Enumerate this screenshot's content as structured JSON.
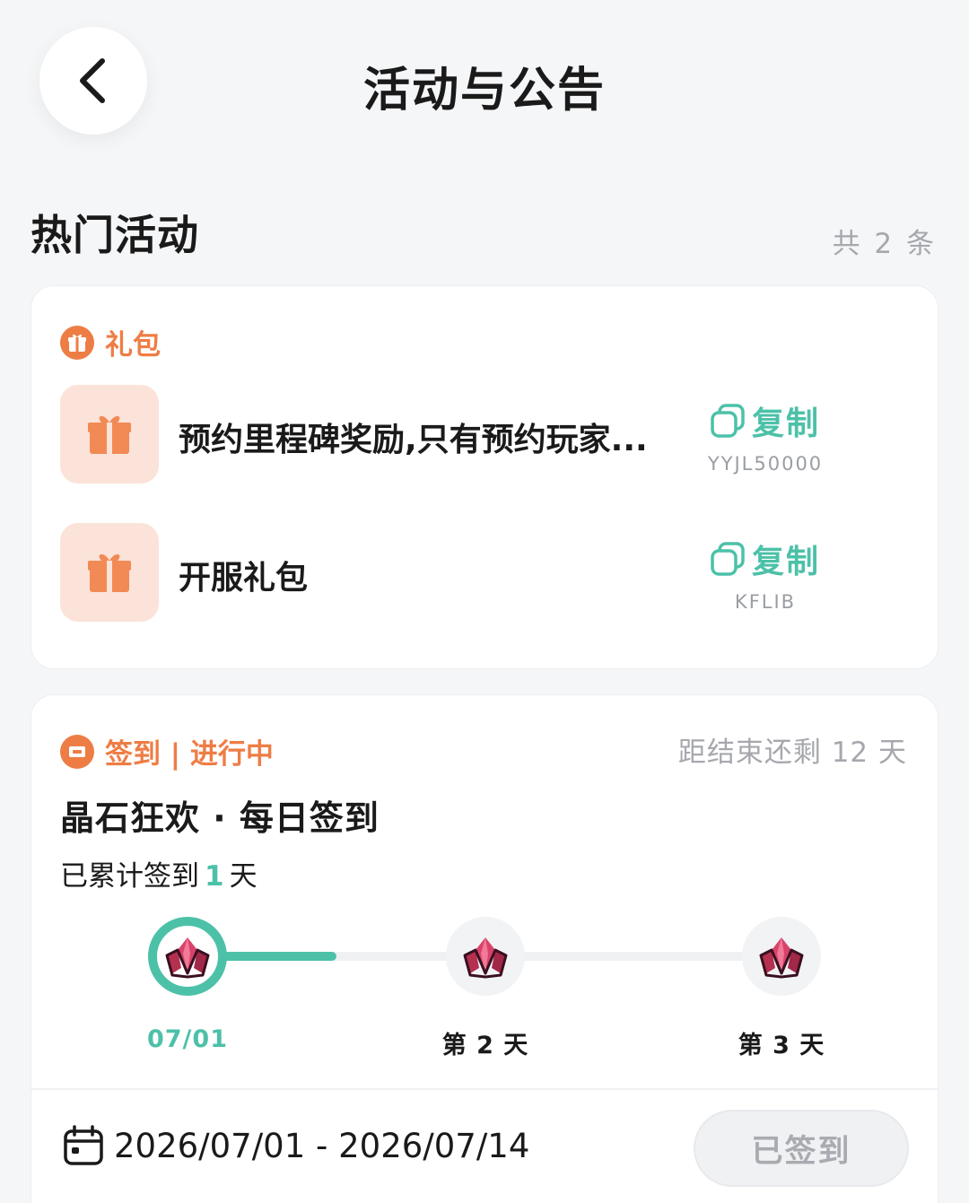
{
  "header": {
    "title": "活动与公告",
    "back_icon": "chevron-left-icon"
  },
  "section": {
    "title": "热门活动",
    "count": "共 2 条"
  },
  "gift_card": {
    "tag": "礼包",
    "tag_icon": "gift-icon",
    "items": [
      {
        "name": "预约里程碑奖励,只有预约玩家...",
        "copy_label": "复制",
        "code": "YYJL50000"
      },
      {
        "name": "开服礼包",
        "copy_label": "复制",
        "code": "KFLIB"
      }
    ]
  },
  "checkin_card": {
    "tag": "签到 | 进行中",
    "tag_icon": "ticket-icon",
    "remaining": "距结束还剩 12 天",
    "title": "晶石狂欢 · 每日签到",
    "progress_prefix": "已累计签到",
    "progress_count": "1",
    "progress_suffix": "天",
    "progress_fraction": 0.25,
    "steps": [
      {
        "label": "07/01",
        "state": "done"
      },
      {
        "label": "第 2 天",
        "state": "pending"
      },
      {
        "label": "第 3 天",
        "state": "pending"
      }
    ],
    "date_range": "2026/07/01 - 2026/07/14",
    "button_label": "已签到"
  },
  "colors": {
    "accent": "#4cc1a8",
    "orange": "#ee7d45",
    "muted": "#a6a8ad",
    "gem": "#c23a5c"
  }
}
